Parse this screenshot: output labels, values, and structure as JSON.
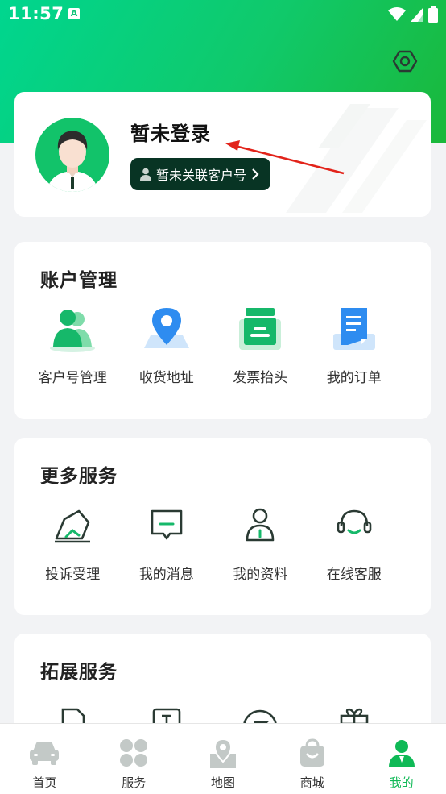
{
  "status_bar": {
    "time": "11:57",
    "notice_icon": "A"
  },
  "profile": {
    "name": "暂未登录",
    "link_label": "暂未关联客户号"
  },
  "account": {
    "title": "账户管理",
    "items": [
      {
        "label": "客户号管理",
        "icon": "users-icon"
      },
      {
        "label": "收货地址",
        "icon": "location-icon"
      },
      {
        "label": "发票抬头",
        "icon": "invoice-icon"
      },
      {
        "label": "我的订单",
        "icon": "order-icon"
      }
    ]
  },
  "more": {
    "title": "更多服务",
    "items": [
      {
        "label": "投诉受理",
        "icon": "complaint-icon"
      },
      {
        "label": "我的消息",
        "icon": "message-icon"
      },
      {
        "label": "我的资料",
        "icon": "profile-icon"
      },
      {
        "label": "在线客服",
        "icon": "headset-icon"
      }
    ]
  },
  "extended": {
    "title": "拓展服务"
  },
  "tabbar": {
    "items": [
      {
        "label": "首页",
        "icon": "car-icon"
      },
      {
        "label": "服务",
        "icon": "grid-icon"
      },
      {
        "label": "地图",
        "icon": "map-icon"
      },
      {
        "label": "商城",
        "icon": "shop-bag-icon"
      },
      {
        "label": "我的",
        "icon": "person-icon"
      }
    ],
    "active": "我的"
  },
  "colors": {
    "brand_green": "#12c36a",
    "active_tab": "#0fb956",
    "link_btn_bg": "#083424",
    "blue_icon": "#2e8cf0"
  }
}
